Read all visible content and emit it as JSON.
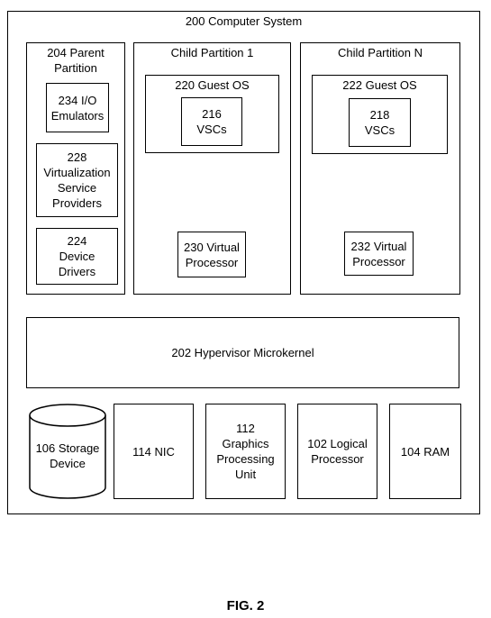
{
  "system": {
    "label": "200 Computer System"
  },
  "parent_partition": {
    "label": "204 Parent Partition",
    "components": [
      {
        "label": "234 I/O Emulators"
      },
      {
        "label": "228 Virtualization Service Providers"
      },
      {
        "label": "224 Device Drivers"
      }
    ]
  },
  "child_partitions": [
    {
      "label": "Child Partition 1",
      "guest_os": "220 Guest OS",
      "vscs": "216 VSCs",
      "virtual_processor": "230 Virtual Processor"
    },
    {
      "label": "Child Partition N",
      "guest_os": "222 Guest OS",
      "vscs": "218 VSCs",
      "virtual_processor": "232 Virtual Processor"
    }
  ],
  "hypervisor": {
    "label": "202 Hypervisor Microkernel"
  },
  "hardware": [
    {
      "label": "106 Storage Device"
    },
    {
      "label": "114 NIC"
    },
    {
      "label": "112 Graphics Processing Unit"
    },
    {
      "label": "102 Logical Processor"
    },
    {
      "label": "104 RAM"
    }
  ],
  "figure_label": "FIG. 2"
}
